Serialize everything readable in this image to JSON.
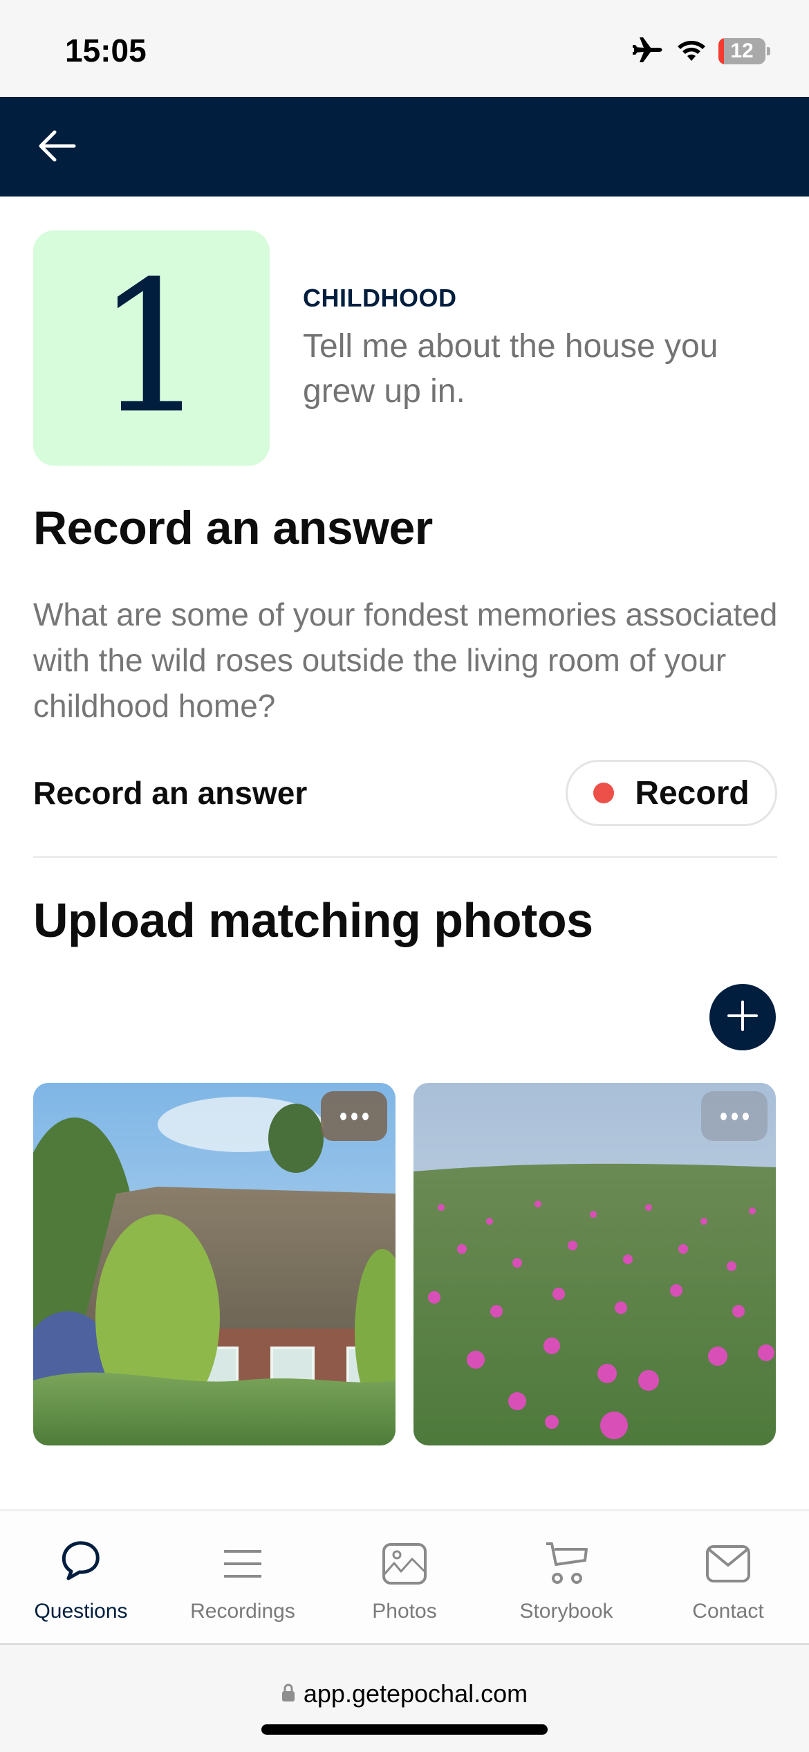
{
  "status_bar": {
    "time": "15:05",
    "battery_level": "12",
    "icons": [
      "airplane-mode-icon",
      "wifi-icon",
      "battery-icon"
    ]
  },
  "header": {
    "back_icon": "arrow-left-icon"
  },
  "question": {
    "number": "1",
    "category": "CHILDHOOD",
    "text": "Tell me about the house you grew up in."
  },
  "record_section": {
    "title": "Record an answer",
    "prompt": "What are some of your fondest memories associated with the wild roses outside the living room of your childhood home?",
    "row_label": "Record an answer",
    "record_button_label": "Record",
    "record_dot_color": "#ec5048"
  },
  "photos_section": {
    "title": "Upload matching photos",
    "add_icon": "plus-icon",
    "photos": [
      {
        "subject": "thatched-roof brick cottage with hydrangeas",
        "menu_icon": "more-horizontal-icon"
      },
      {
        "subject": "field of pink wild roses",
        "menu_icon": "more-horizontal-icon"
      }
    ]
  },
  "bottom_nav": {
    "items": [
      {
        "label": "Questions",
        "icon": "speech-bubble-icon",
        "active": true
      },
      {
        "label": "Recordings",
        "icon": "list-icon",
        "active": false
      },
      {
        "label": "Photos",
        "icon": "image-icon",
        "active": false
      },
      {
        "label": "Storybook",
        "icon": "cart-icon",
        "active": false
      },
      {
        "label": "Contact",
        "icon": "mail-icon",
        "active": false
      }
    ]
  },
  "browser": {
    "url": "app.getepochal.com",
    "lock_icon": "lock-icon"
  },
  "colors": {
    "brand_navy": "#011e3e",
    "tile_green": "#d7fcdc",
    "record_red": "#ec5048",
    "muted_text": "#767676"
  }
}
